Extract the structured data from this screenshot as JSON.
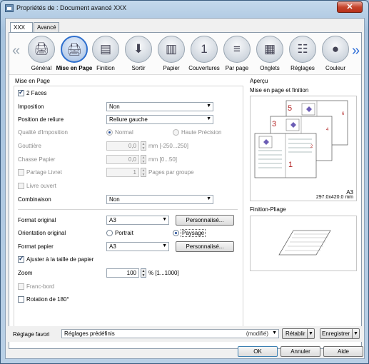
{
  "window": {
    "title": "Propriétés de : Document avancé XXX",
    "close_glyph": "✕"
  },
  "tabs": [
    {
      "label": "XXX"
    },
    {
      "label": "Avancé"
    }
  ],
  "ribbon": {
    "left_arrow": "«",
    "right_arrow": "»",
    "items": [
      {
        "label": "Général",
        "icon": "printer-icon",
        "glyph": "🖨"
      },
      {
        "label": "Mise en Page",
        "icon": "layout-icon",
        "glyph": "🖨"
      },
      {
        "label": "Finition",
        "icon": "finishing-icon",
        "glyph": "▤"
      },
      {
        "label": "Sortir",
        "icon": "output-tray-icon",
        "glyph": "⬇"
      },
      {
        "label": "Papier",
        "icon": "paper-icon",
        "glyph": "▥"
      },
      {
        "label": "Couvertures",
        "icon": "cover-icon",
        "glyph": "1"
      },
      {
        "label": "Par page",
        "icon": "per-page-icon",
        "glyph": "≡"
      },
      {
        "label": "Onglets",
        "icon": "tabs-icon",
        "glyph": "▦"
      },
      {
        "label": "Réglages",
        "icon": "settings-icon",
        "glyph": "☷"
      },
      {
        "label": "Couleur",
        "icon": "color-icon",
        "glyph": "●"
      }
    ]
  },
  "layout": {
    "section_title": "Mise en Page",
    "two_sided": {
      "label": "2 Faces",
      "checked": true
    },
    "imposition": {
      "label": "Imposition",
      "value": "Non"
    },
    "binding": {
      "label": "Position de reliure",
      "value": "Reliure gauche"
    },
    "quality": {
      "label": "Qualité d'Imposition",
      "normal": "Normal",
      "high": "Haute Précision"
    },
    "gutter": {
      "label": "Gouttière",
      "value": "0,0",
      "unit": "mm [-250...250]"
    },
    "creep": {
      "label": "Chasse Papier",
      "value": "0,0",
      "unit": "mm [0...50]"
    },
    "split_booklet": {
      "label": "Partage Livret",
      "value": "1",
      "unit": "Pages par groupe"
    },
    "open_book": {
      "label": "Livre ouvert"
    },
    "combination": {
      "label": "Combinaison",
      "value": "Non"
    },
    "original_size": {
      "label": "Format original",
      "value": "A3",
      "custom": "Personnalisé..."
    },
    "orientation": {
      "label": "Orientation original",
      "portrait": "Portrait",
      "landscape": "Paysage"
    },
    "paper_size": {
      "label": "Format papier",
      "value": "A3",
      "custom": "Personnalisé..."
    },
    "fit_to_paper": {
      "label": "Ajuster à la taille de papier",
      "checked": true
    },
    "zoom": {
      "label": "Zoom",
      "value": "100",
      "unit": "% [1...1000]"
    },
    "full_bleed": {
      "label": "Franc-bord"
    },
    "rotate": {
      "label": "Rotation de 180°"
    }
  },
  "preview": {
    "section_title": "Aperçu",
    "title": "Mise en page et finition",
    "page_numbers": [
      "5",
      "6",
      "3",
      "4",
      "1",
      "2"
    ],
    "paper_label": "A3",
    "paper_dims": "297.0x420.0 mm",
    "finish_title": "Finition-Pliage"
  },
  "favorites": {
    "label": "Réglage favori",
    "value": "Réglages prédéfinis",
    "modified": "(modifié)",
    "restore": "Rétablir",
    "save": "Enregistrer"
  },
  "buttons": {
    "ok": "OK",
    "cancel": "Annuler",
    "help": "Aide"
  },
  "colors": {
    "title_gradient_top": "#c4d9ec",
    "selected_icon_border": "#2e6fce",
    "page_number_red": "#b22222"
  }
}
